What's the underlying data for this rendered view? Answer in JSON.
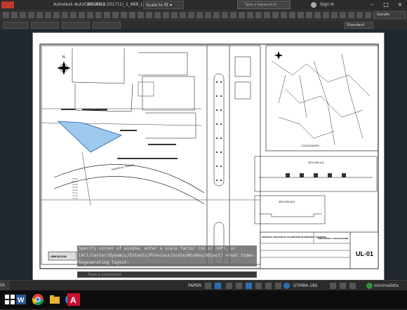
{
  "window": {
    "app_title": "Autodesk AutoCAD 2019",
    "file_title": "URSAS-2.2017(1)_1_888_L(r)(b)(tr).dwg",
    "scale_label": "Scale to fit",
    "search_placeholder": "Type a keyword or phrase",
    "signin_label": "Sign In",
    "standard_label": "Standard",
    "gen_label": "GenAn"
  },
  "drawing": {
    "sheet_code": "UL-01",
    "north_label": "N",
    "road_label": "AVENIDA EL TRABAJO",
    "location_label": "LOCALIZACION",
    "section_label": "SECCION A-A",
    "section2_label": "SECCION B-B",
    "title_block": "PROYECTO: CREACION DE LOS SERVICIOS DE ATENCION Y ASISTENCIA",
    "subtitle_block": "UBICACION Y LOCALIZACION",
    "ubicacion_label": "UBICACION"
  },
  "command": {
    "lines": [
      "Specify corner of window, enter a scale factor (nX or nXP), or",
      "[All/Center/Dynamic/Extents/Previous/Scale/Window/Object] <real time>:",
      "Regenerating layout."
    ],
    "input_placeholder": "Type a command"
  },
  "status": {
    "left_tab": "UL",
    "paper_label": "PAPER",
    "coord_label": "UTM84-18S",
    "style_label": "minimalista"
  },
  "taskbar": {
    "apps": [
      "windows-start",
      "word",
      "chrome",
      "explorer",
      "edge",
      "ppt",
      "autocad"
    ]
  }
}
